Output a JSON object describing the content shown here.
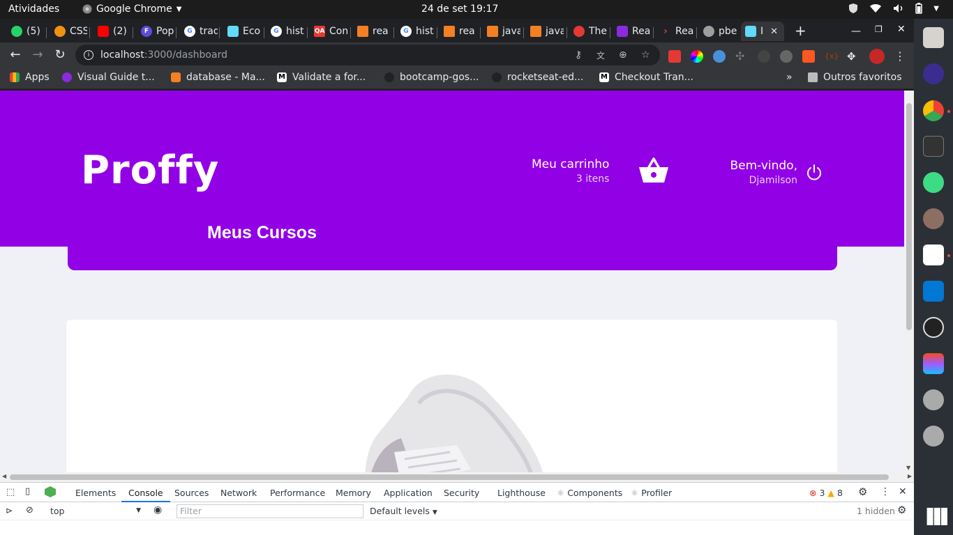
{
  "system_bar": {
    "activities": "Atividades",
    "app_name": "Google Chrome",
    "clock": "24 de set  19:17"
  },
  "tabs": [
    {
      "label": "(5)",
      "color": "#25d366"
    },
    {
      "label": "CSS",
      "color": "#f29111"
    },
    {
      "label": "(2)",
      "color": "#ff0000"
    },
    {
      "label": "Pop",
      "color": "#5b4cdb"
    },
    {
      "label": "trad",
      "color": "#4285f4"
    },
    {
      "label": "Eco",
      "color": "#61dafb"
    },
    {
      "label": "hist",
      "color": "#4285f4"
    },
    {
      "label": "Con",
      "color": "#e53935"
    },
    {
      "label": "rea",
      "color": "#f48024"
    },
    {
      "label": "hist",
      "color": "#4285f4"
    },
    {
      "label": "rea",
      "color": "#f48024"
    },
    {
      "label": "java",
      "color": "#f48024"
    },
    {
      "label": "java",
      "color": "#f48024"
    },
    {
      "label": "The",
      "color": "#e53935"
    },
    {
      "label": "Rea",
      "color": "#8a2be2"
    },
    {
      "label": "Rea",
      "color": "#e53935"
    },
    {
      "label": "pbe",
      "color": "#9e9e9e"
    },
    {
      "label": "I",
      "color": "#61dafb"
    }
  ],
  "toolbar": {
    "url_host": "localhost",
    "url_path": ":3000/dashboard"
  },
  "bookmarks": [
    {
      "label": "Apps"
    },
    {
      "label": "Visual Guide t..."
    },
    {
      "label": "database - Ma..."
    },
    {
      "label": "Validate a for..."
    },
    {
      "label": "bootcamp-gos..."
    },
    {
      "label": "rocketseat-ed..."
    },
    {
      "label": "Checkout Tran..."
    },
    {
      "label": "Outros favoritos"
    }
  ],
  "page": {
    "logo": "Proffy",
    "cart_title": "Meu carrinho",
    "cart_count": "3 itens",
    "welcome": "Bem-vindo,",
    "username": "Djamilson",
    "section_title": "Meus Cursos",
    "brand_color": "#9200e6"
  },
  "devtools": {
    "tabs": [
      "Elements",
      "Console",
      "Sources",
      "Network",
      "Performance",
      "Memory",
      "Application",
      "Security",
      "Lighthouse",
      "Components",
      "Profiler"
    ],
    "errors": "3",
    "warnings": "8",
    "context": "top",
    "filter_placeholder": "Filter",
    "levels": "Default levels",
    "hidden": "1 hidden"
  }
}
